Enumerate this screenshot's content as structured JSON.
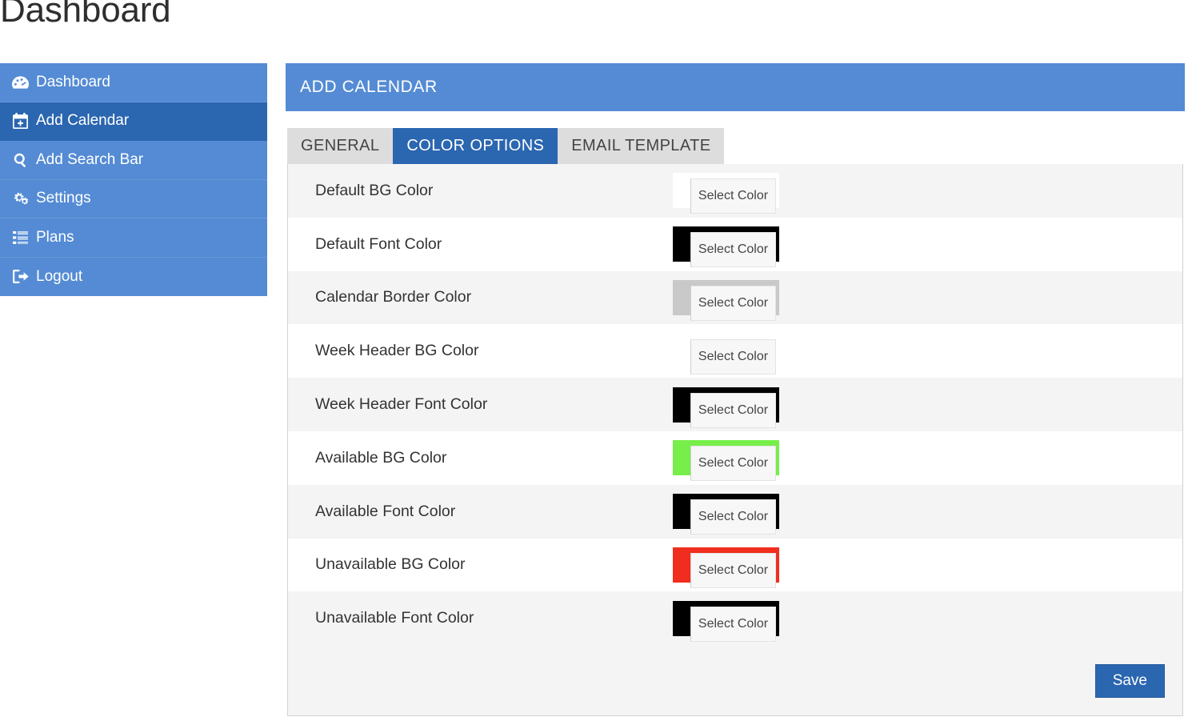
{
  "page": {
    "title": "Dashboard"
  },
  "sidebar": {
    "items": [
      {
        "label": "Dashboard",
        "icon": "dashboard-icon",
        "active": false
      },
      {
        "label": "Add Calendar",
        "icon": "calendar-plus-icon",
        "active": true
      },
      {
        "label": "Add Search Bar",
        "icon": "search-icon",
        "active": false
      },
      {
        "label": "Settings",
        "icon": "gears-icon",
        "active": false
      },
      {
        "label": "Plans",
        "icon": "list-icon",
        "active": false
      },
      {
        "label": "Logout",
        "icon": "sign-out-icon",
        "active": false
      }
    ]
  },
  "panel": {
    "header": "ADD CALENDAR",
    "tabs": [
      {
        "label": "GENERAL",
        "active": false
      },
      {
        "label": "COLOR OPTIONS",
        "active": true
      },
      {
        "label": "EMAIL TEMPLATE",
        "active": false
      }
    ],
    "rows": [
      {
        "label": "Default BG Color",
        "button": "Select Color",
        "color": "#ffffff"
      },
      {
        "label": "Default Font Color",
        "button": "Select Color",
        "color": "#000000"
      },
      {
        "label": "Calendar Border Color",
        "button": "Select Color",
        "color": "#c9c9c9"
      },
      {
        "label": "Week Header BG Color",
        "button": "Select Color",
        "color": "#ffffff"
      },
      {
        "label": "Week Header Font Color",
        "button": "Select Color",
        "color": "#000000"
      },
      {
        "label": "Available BG Color",
        "button": "Select Color",
        "color": "#77ee4a"
      },
      {
        "label": "Available Font Color",
        "button": "Select Color",
        "color": "#000000"
      },
      {
        "label": "Unavailable BG Color",
        "button": "Select Color",
        "color": "#f02d1e"
      },
      {
        "label": "Unavailable Font Color",
        "button": "Select Color",
        "color": "#000000"
      }
    ],
    "save_label": "Save"
  },
  "theme": {
    "sidebar_blue": "#548bd4",
    "sidebar_active_blue": "#2b66b0",
    "header_blue": "#548bd4",
    "tab_active_blue": "#2b66b0",
    "tab_inactive_gray": "#dddddd",
    "row_alt_gray": "#f4f4f4"
  }
}
